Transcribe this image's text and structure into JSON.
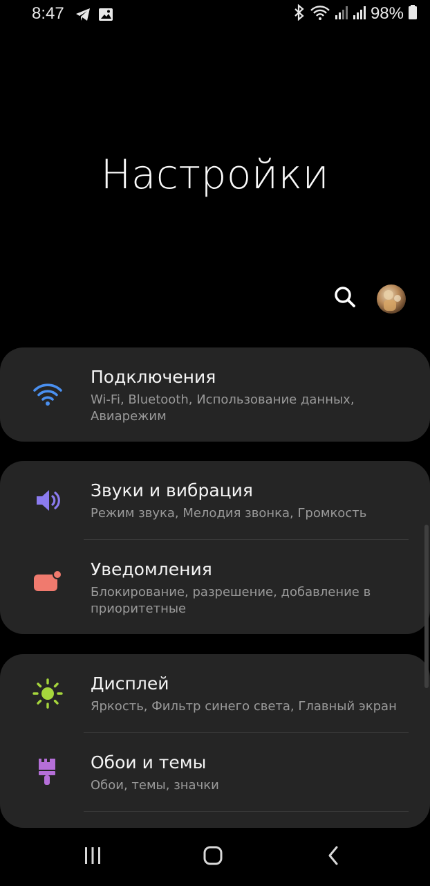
{
  "status_bar": {
    "time": "8:47",
    "left_icons": [
      "telegram-icon",
      "image-icon"
    ],
    "right_icons": [
      "bluetooth-icon",
      "wifi-icon",
      "signal-icon",
      "signal-icon"
    ],
    "battery": "98%"
  },
  "header": {
    "title": "Настройки"
  },
  "actions": {
    "search_icon": "search-icon",
    "avatar_icon": "avatar"
  },
  "settings": [
    {
      "icon": "wifi-icon",
      "color": "#4a90f0",
      "title": "Подключения",
      "subtitle": "Wi-Fi, Bluetooth, Использование данных, Авиарежим"
    },
    {
      "icon": "volume-icon",
      "color": "#8b7bf0",
      "title": "Звуки и вибрация",
      "subtitle": "Режим звука, Мелодия звонка, Громкость"
    },
    {
      "icon": "notifications-icon",
      "color": "#f07a6e",
      "title": "Уведомления",
      "subtitle": "Блокирование, разрешение, добавление в приоритетные"
    },
    {
      "icon": "brightness-icon",
      "color": "#a6d63c",
      "title": "Дисплей",
      "subtitle": "Яркость, Фильтр синего света, Главный экран"
    },
    {
      "icon": "paint-brush-icon",
      "color": "#b56fd8",
      "title": "Обои и темы",
      "subtitle": "Обои, темы, значки"
    }
  ],
  "nav_bar": {
    "recents_icon": "recents-icon",
    "home_icon": "home-icon",
    "back_icon": "back-icon"
  }
}
